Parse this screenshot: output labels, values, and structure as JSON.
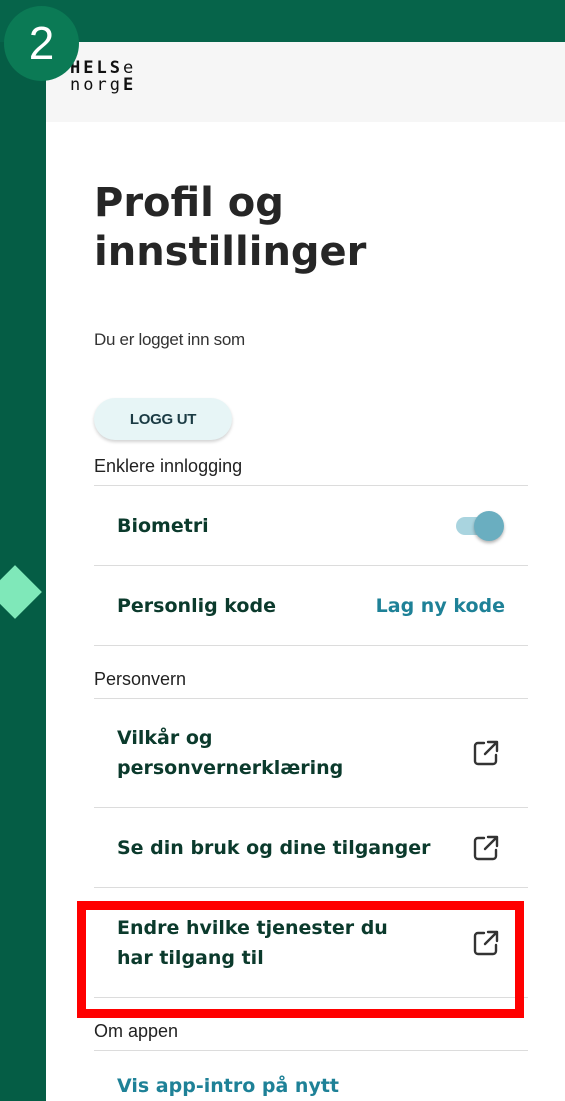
{
  "overlay": {
    "step_number": "2"
  },
  "logo": {
    "line1_bold": "HELS",
    "line1_light": "e",
    "line2_light": "norg",
    "line2_bold": "E"
  },
  "page": {
    "title": "Profil og innstillinger",
    "signed_in_as": "Du er logget inn som",
    "logout_label": "LOGG UT"
  },
  "sections": {
    "login": {
      "label": "Enklere innlogging",
      "biometrics": {
        "label": "Biometri",
        "enabled": true
      },
      "personal_code": {
        "label": "Personlig kode",
        "action": "Lag ny kode"
      }
    },
    "privacy": {
      "label": "Personvern",
      "items": [
        {
          "label": "Vilkår og personvernerklæring",
          "icon": "external-link-icon"
        },
        {
          "label": "Se din bruk og dine tilganger",
          "icon": "external-link-icon"
        },
        {
          "label": "Endre hvilke tjenester du har tilgang til",
          "icon": "external-link-icon"
        }
      ]
    },
    "about": {
      "label": "Om appen",
      "first_item": "Vis app-intro på nytt"
    }
  },
  "colors": {
    "brand_green": "#055d45",
    "link": "#1e8197",
    "text_dark": "#0b3a2c",
    "highlight": "#ff0000"
  }
}
